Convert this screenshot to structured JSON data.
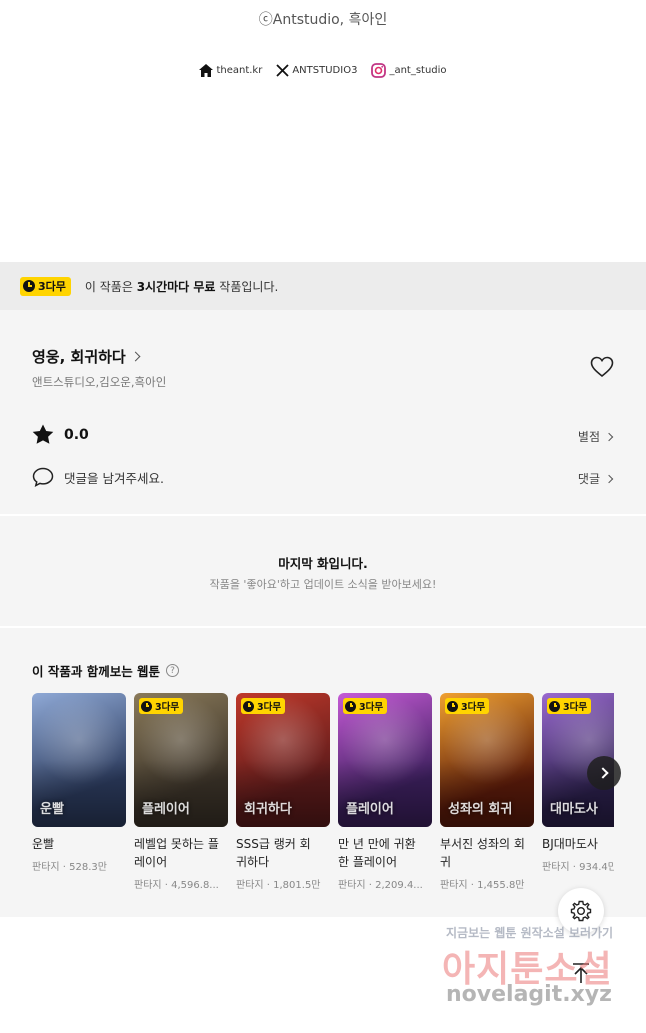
{
  "credit": "ⓒAntstudio, 흑아인",
  "social": [
    {
      "icon": "home-icon",
      "label": "theant.kr"
    },
    {
      "icon": "x-logo-icon",
      "label": "ANTSTUDIO3"
    },
    {
      "icon": "instagram-icon",
      "label": "_ant_studio"
    }
  ],
  "notice": {
    "badge": "3다무",
    "prefix": "이 작품은 ",
    "bold": "3시간마다 무료",
    "suffix": " 작품입니다."
  },
  "work": {
    "title": "영웅, 회귀하다",
    "authors": "앤트스튜디오,김오운,흑아인",
    "rating": "0.0",
    "rate_link": "별점",
    "comment_prompt": "댓글을 남겨주세요.",
    "comment_link": "댓글"
  },
  "last_episode": {
    "title": "마지막 화입니다.",
    "subtitle": "작품을 '좋아요'하고 업데이트 소식을 받아보세요!"
  },
  "recommend": {
    "heading": "이 작품과 함께보는 웹툰",
    "help": "?",
    "items": [
      {
        "title": "운빨",
        "title2": "",
        "meta": "판타지 · 528.3만",
        "badge": "",
        "art": "운빨",
        "c1": "#2b3a5c",
        "c2": "#8fa9d6"
      },
      {
        "title": "레벨업 못하는 플",
        "title2": "레이어",
        "meta": "판타지 · 4,596.8...",
        "badge": "3다무",
        "art": "플레이어",
        "c1": "#3a3228",
        "c2": "#8a7a5a"
      },
      {
        "title": "SSS급 랭커 회",
        "title2": "귀하다",
        "meta": "판타지 · 1,801.5만",
        "badge": "3다무",
        "art": "회귀하다",
        "c1": "#5a1a1a",
        "c2": "#c0392b"
      },
      {
        "title": "만 년 만에 귀환",
        "title2": "한 플레이어",
        "meta": "판타지 · 2,209.4...",
        "badge": "3다무",
        "art": "플레이어",
        "c1": "#3b1f5c",
        "c2": "#c55ad6"
      },
      {
        "title": "부서진 성좌의 회",
        "title2": "귀",
        "meta": "판타지 · 1,455.8만",
        "badge": "3다무",
        "art": "성좌의 회귀",
        "c1": "#5a1a0a",
        "c2": "#f0a030"
      },
      {
        "title": "BJ대마도사",
        "title2": "",
        "meta": "판타지 · 934.4만",
        "badge": "3다무",
        "art": "대마도사",
        "c1": "#2a1f4a",
        "c2": "#9a6ad0"
      }
    ]
  },
  "watermark": {
    "top": "지금보는 웹툰 원작소설 보러가기",
    "mid": "아지툰소설",
    "bottom": "novelagit.xyz"
  }
}
